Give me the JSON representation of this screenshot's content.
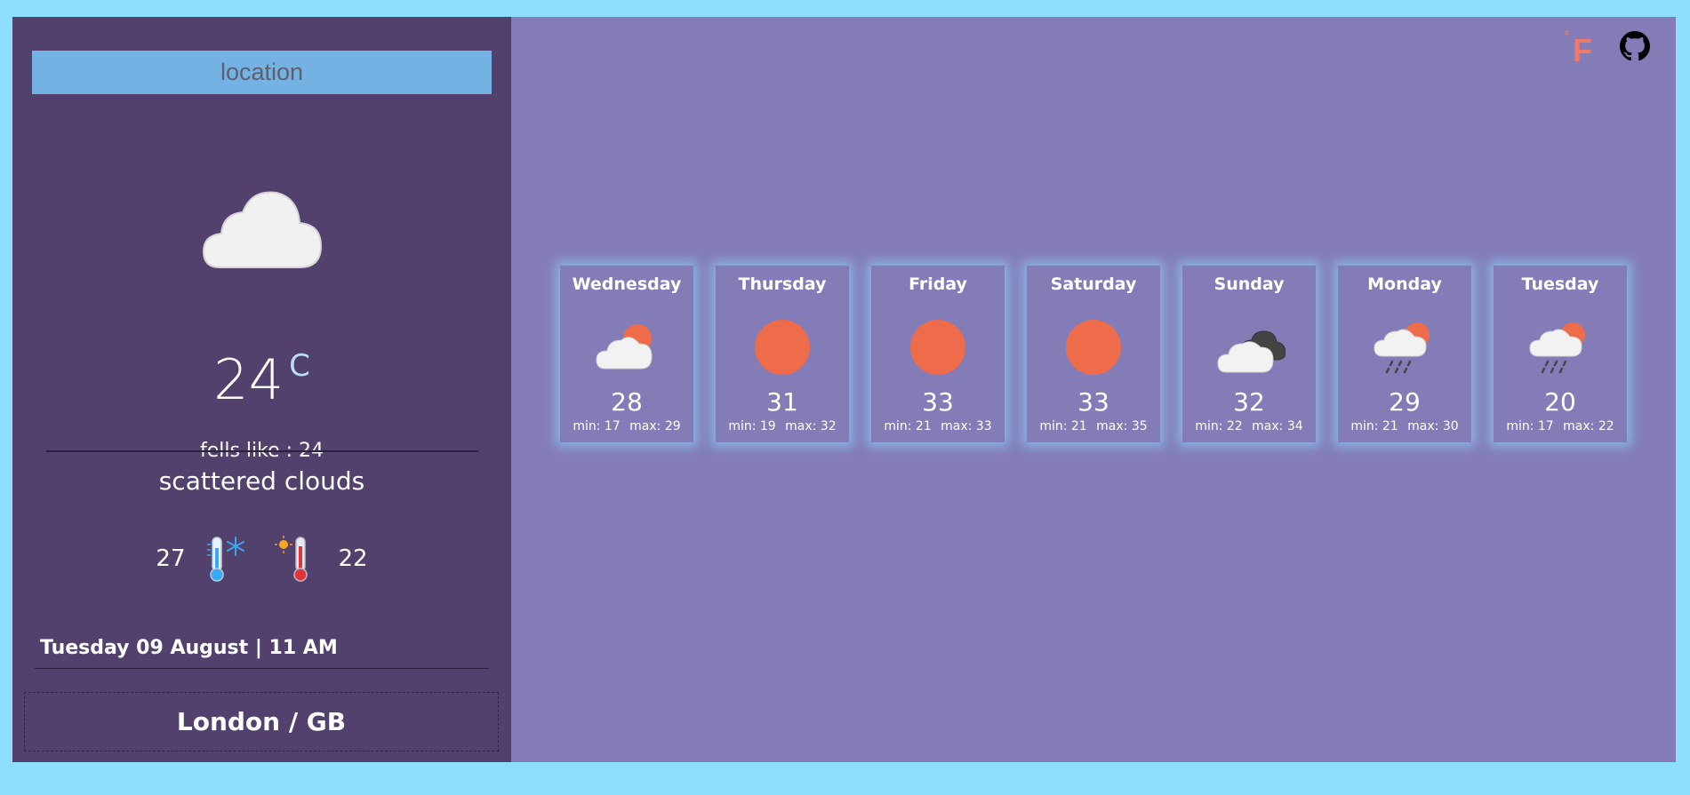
{
  "search": {
    "placeholder": "location"
  },
  "current": {
    "icon": "cloud-icon",
    "temp": "24",
    "unit": "C",
    "feels_like": "fells like : 24",
    "description": "scattered clouds",
    "min_cold": "27",
    "max_hot": "22",
    "datetime": "Tuesday 09 August | 11 AM",
    "city": "London / GB"
  },
  "header": {
    "unit_toggle_label": "°F",
    "github_icon": "github-icon"
  },
  "forecast": [
    {
      "day": "Wednesday",
      "icon": "cloud-sun-icon",
      "temp": "28",
      "min": "min: 17",
      "max": "max: 29"
    },
    {
      "day": "Thursday",
      "icon": "sun-icon",
      "temp": "31",
      "min": "min: 19",
      "max": "max: 32"
    },
    {
      "day": "Friday",
      "icon": "sun-icon",
      "temp": "33",
      "min": "min: 21",
      "max": "max: 33"
    },
    {
      "day": "Saturday",
      "icon": "sun-icon",
      "temp": "33",
      "min": "min: 21",
      "max": "max: 35"
    },
    {
      "day": "Sunday",
      "icon": "broken-clouds-icon",
      "temp": "32",
      "min": "min: 22",
      "max": "max: 34"
    },
    {
      "day": "Monday",
      "icon": "rain-sun-icon",
      "temp": "29",
      "min": "min: 21",
      "max": "max: 30"
    },
    {
      "day": "Tuesday",
      "icon": "rain-sun-icon",
      "temp": "20",
      "min": "min: 17",
      "max": "max: 22"
    }
  ],
  "colors": {
    "background": "#8ddffd",
    "sidebar": "#52406d",
    "main": "#847cb7",
    "search": "#74b2e3",
    "sun": "#ef6c4b",
    "unit_toggle": "#f07a6a"
  }
}
